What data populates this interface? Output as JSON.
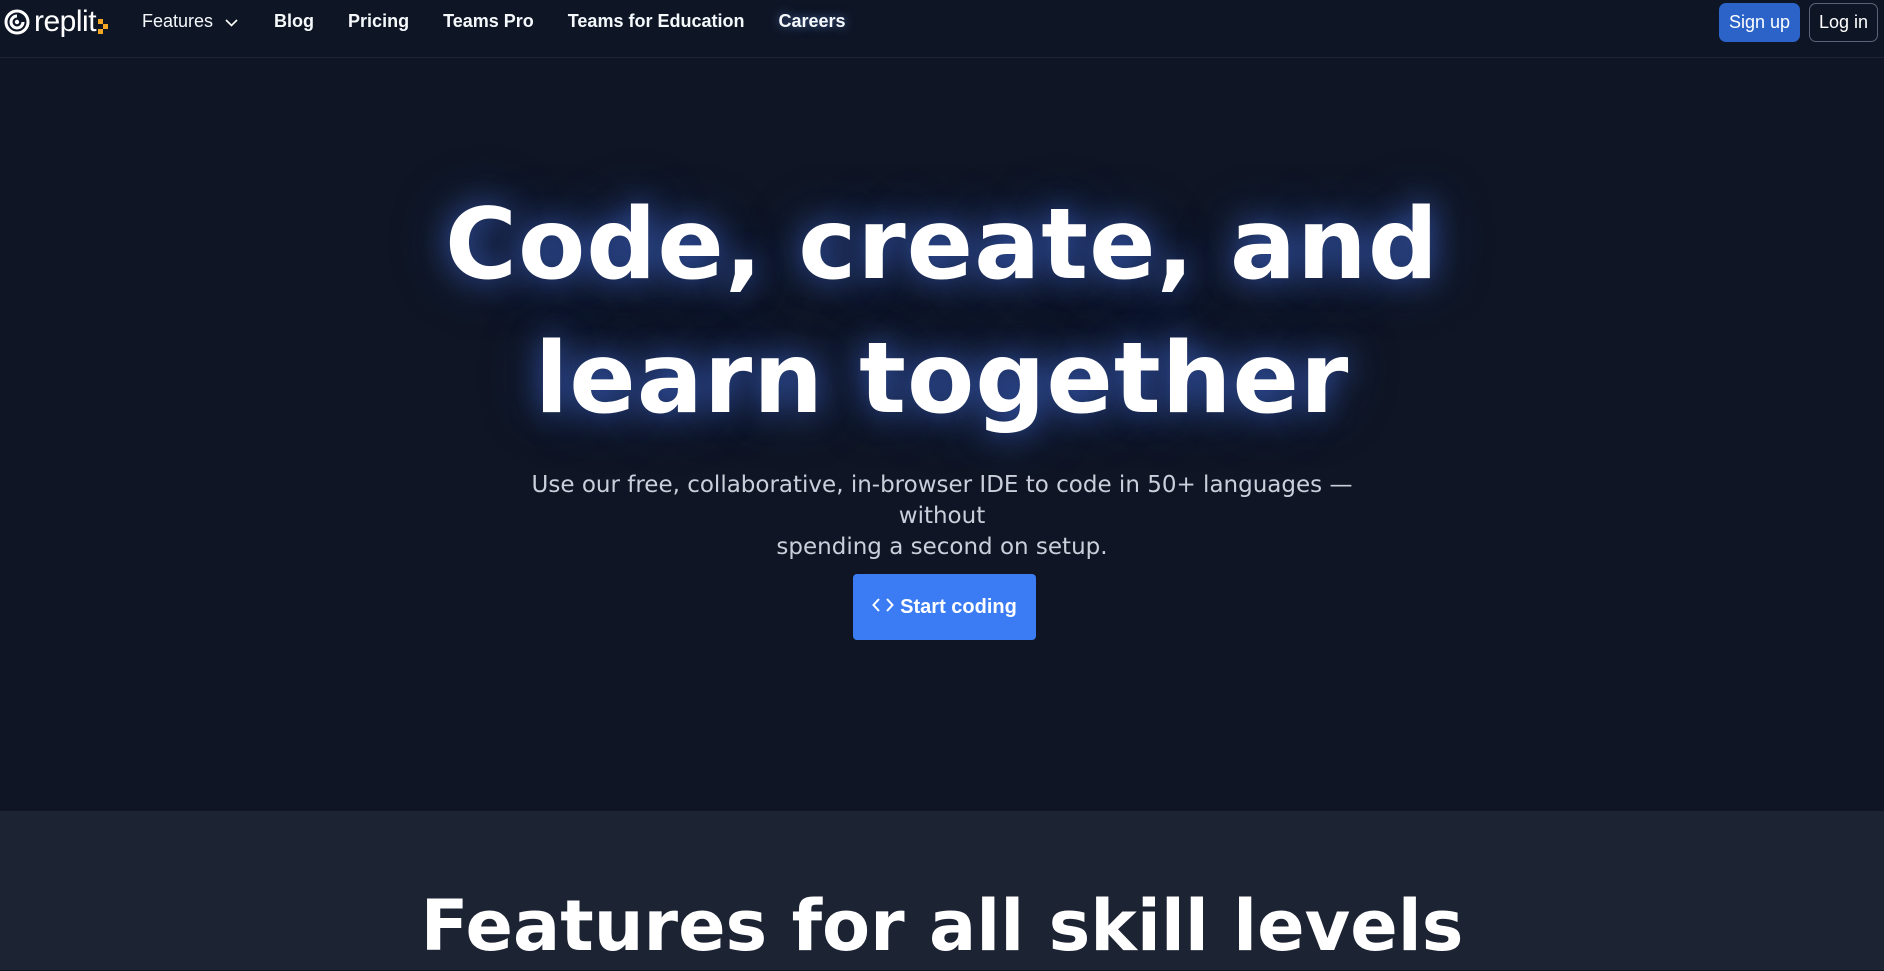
{
  "navbar": {
    "logo_text": "replit",
    "items": [
      {
        "label": "Features",
        "has_dropdown": true
      },
      {
        "label": "Blog"
      },
      {
        "label": "Pricing"
      },
      {
        "label": "Teams Pro"
      },
      {
        "label": "Teams for Education"
      },
      {
        "label": "Careers"
      }
    ],
    "signup_label": "Sign up",
    "login_label": "Log in"
  },
  "hero": {
    "title_line1": "Code, create, and",
    "title_line2": "learn together",
    "subtitle_line1": "Use our free, collaborative, in-browser IDE to code in 50+ languages — without",
    "subtitle_line2": "spending a second on setup.",
    "cta_label": "Start coding",
    "cta_icon": "code-brackets-icon"
  },
  "features": {
    "title": "Features for all skill levels"
  },
  "colors": {
    "background": "#0f1524",
    "navbar": "#0e1525",
    "signup_button": "#2b63c9",
    "cta_button": "#3b7cf5",
    "features_background": "#1c2333",
    "logo_accent": "#f5a623"
  }
}
